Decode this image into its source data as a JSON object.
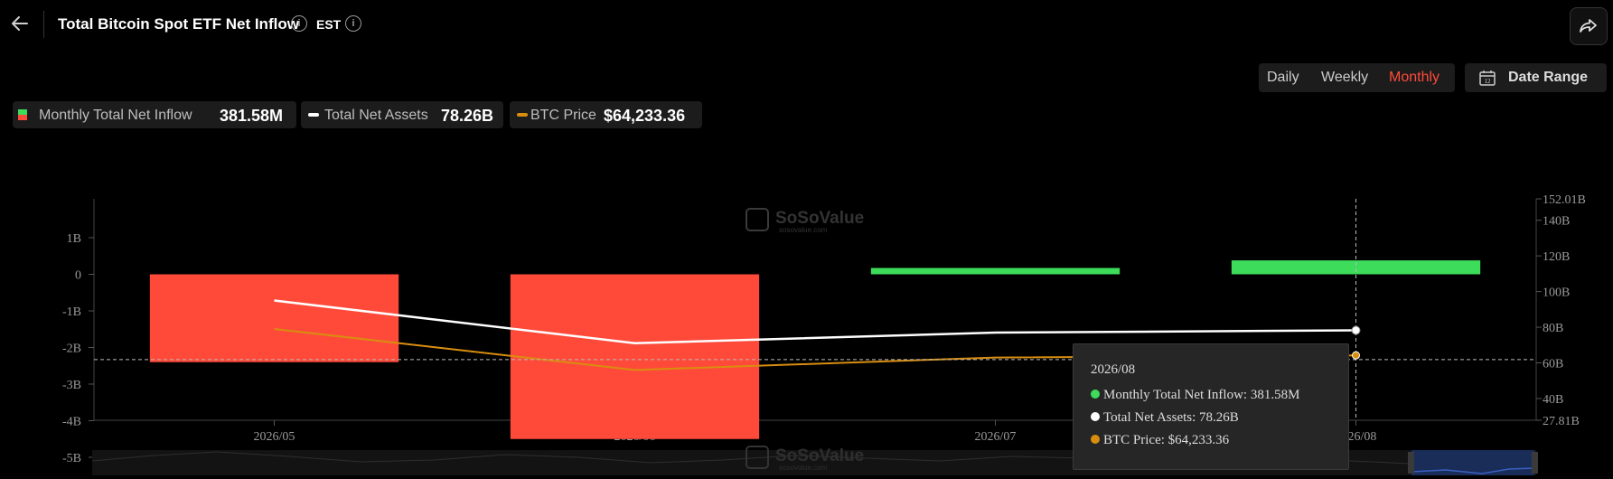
{
  "header": {
    "title": "Total Bitcoin Spot ETF Net Inflow",
    "timezone": "EST"
  },
  "period": {
    "options": [
      "Daily",
      "Weekly",
      "Monthly"
    ],
    "selected": "Monthly",
    "date_range_label": "Date Range"
  },
  "legend": {
    "inflow_name": "Monthly Total Net Inflow",
    "inflow_value": "381.58M",
    "assets_name": "Total Net Assets",
    "assets_value": "78.26B",
    "price_name": "BTC Price",
    "price_value": "$64,233.36"
  },
  "watermark": {
    "brand": "SoSoValue",
    "url": "sosovalue.com"
  },
  "tooltip": {
    "date": "2026/08",
    "inflow": "Monthly Total Net Inflow: 381.58M",
    "assets": "Total Net Assets: 78.26B",
    "price": "BTC Price: $64,233.36"
  },
  "colors": {
    "positive": "#3ddc5a",
    "negative": "#ff4a3a",
    "assets_line": "#ffffff",
    "price_line": "#d98d0f",
    "accent": "#ff4a3a"
  },
  "chart_data": {
    "type": "bar",
    "categories": [
      "2026/05",
      "2026/06",
      "2026/07",
      "2026/08"
    ],
    "series": [
      {
        "name": "Monthly Total Net Inflow",
        "type": "bar",
        "axis": "left",
        "values": [
          -2.4,
          -4.5,
          0.16,
          0.38
        ]
      },
      {
        "name": "Total Net Assets",
        "type": "line",
        "axis": "right",
        "values": [
          95,
          71,
          77,
          78.26
        ]
      },
      {
        "name": "BTC Price",
        "type": "line",
        "axis": "right",
        "values": [
          79,
          56,
          63,
          64.23
        ]
      }
    ],
    "y_left": {
      "ticks": [
        "1B",
        "0",
        "-1B",
        "-2B",
        "-3B",
        "-4B",
        "-5B"
      ],
      "tick_values": [
        1,
        0,
        -1,
        -2,
        -3,
        -4,
        -5
      ],
      "range": [
        -5,
        1
      ]
    },
    "y_right": {
      "ticks": [
        "152.01B",
        "140B",
        "120B",
        "100B",
        "80B",
        "60B",
        "40B",
        "27.81B"
      ],
      "tick_values": [
        152.01,
        140,
        120,
        100,
        80,
        60,
        40,
        27.81
      ],
      "range": [
        27.81,
        152.01
      ]
    },
    "crosshair_category": "2026/08",
    "crosshair_left_value": -2.33,
    "grid": false,
    "legend_position": "top-left"
  }
}
